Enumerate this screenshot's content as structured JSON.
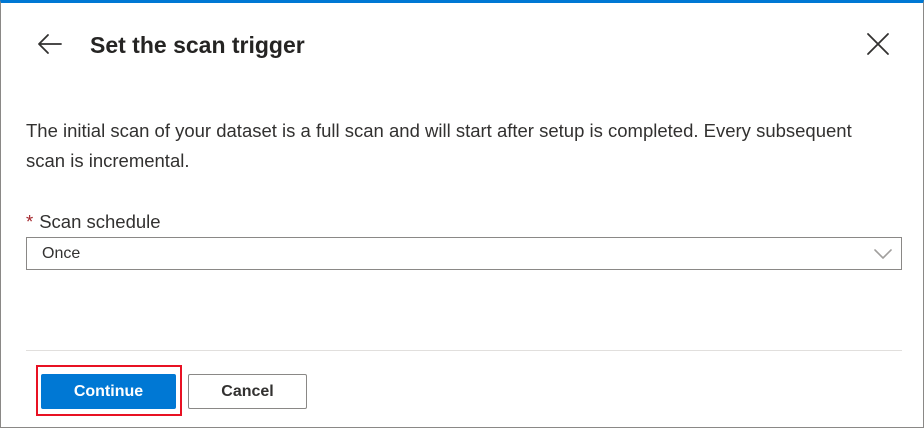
{
  "header": {
    "title": "Set the scan trigger",
    "back_icon": "arrow-left-icon",
    "close_icon": "close-icon"
  },
  "description": "The initial scan of your dataset is a full scan and will start after setup is completed. Every subsequent scan is incremental.",
  "scan_schedule": {
    "required_marker": "*",
    "label": "Scan schedule",
    "selected_value": "Once",
    "dropdown_icon": "chevron-down-icon"
  },
  "footer": {
    "continue_label": "Continue",
    "cancel_label": "Cancel"
  },
  "colors": {
    "accent": "#0078d4",
    "required": "#a4262c",
    "highlight": "#e81123"
  }
}
